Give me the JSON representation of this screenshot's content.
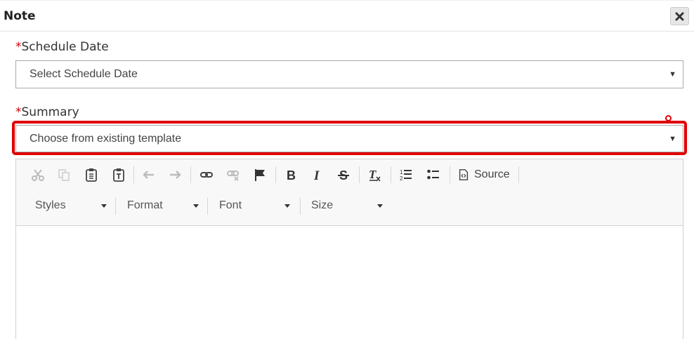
{
  "dialog": {
    "title": "Note"
  },
  "schedule_date": {
    "required_marker": "*",
    "label": "Schedule Date",
    "value": "Select Schedule Date"
  },
  "summary": {
    "required_marker": "*",
    "label": "Summary",
    "template_value": "Choose from existing template"
  },
  "toolbar": {
    "source_label": "Source",
    "styles_label": "Styles",
    "format_label": "Format",
    "font_label": "Font",
    "size_label": "Size"
  },
  "colors": {
    "highlight": "#e00000",
    "required": "#cc0000"
  }
}
